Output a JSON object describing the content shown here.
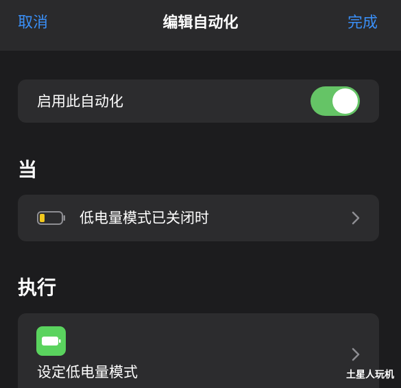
{
  "navbar": {
    "cancel_label": "取消",
    "title": "编辑自动化",
    "done_label": "完成"
  },
  "enable": {
    "label": "启用此自动化",
    "toggle_on": true
  },
  "sections": {
    "when_header": "当",
    "do_header": "执行"
  },
  "trigger": {
    "label": "低电量模式已关闭时",
    "icon": "battery-low-icon"
  },
  "action": {
    "label": "设定低电量模式",
    "icon": "battery-app-icon"
  },
  "watermark": "土星人玩机",
  "colors": {
    "accent": "#3a8ff7",
    "toggle_on": "#65c466",
    "card": "#2c2c2e",
    "background": "#1c1c1e",
    "battery_level": "#f2c81d",
    "action_icon": "#5ad35e"
  }
}
